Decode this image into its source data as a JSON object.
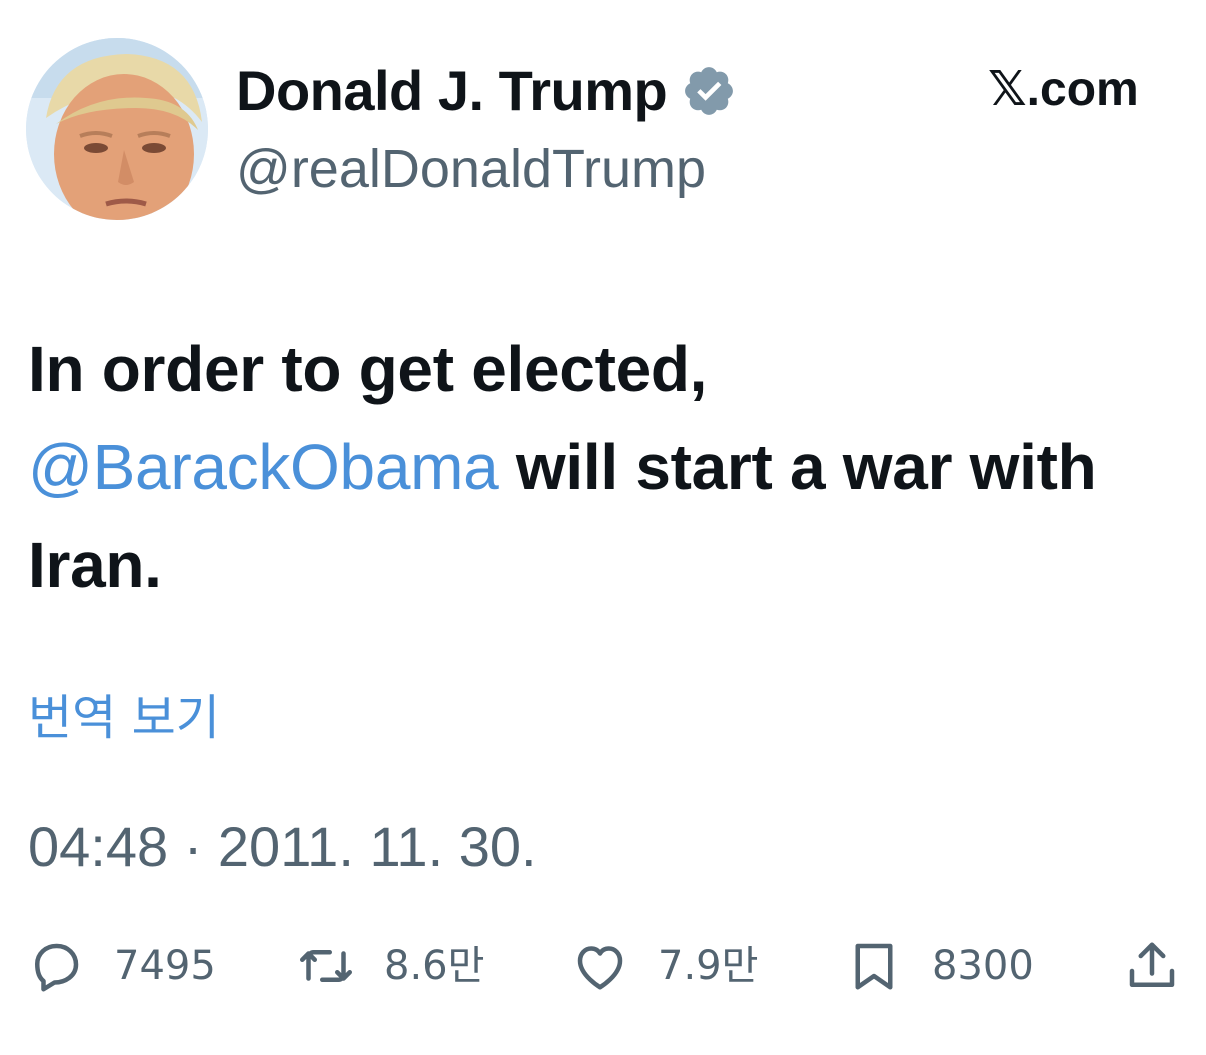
{
  "author": {
    "display_name": "Donald J. Trump",
    "handle": "@realDonaldTrump",
    "verified": true
  },
  "site_label": "𝕏.com",
  "tweet": {
    "line1": "In order to get elected,",
    "mention": "@BarackObama",
    "line2_rest": " will start a war with",
    "line3": "Iran."
  },
  "translate_label": "번역 보기",
  "timestamp": "04:48 · 2011. 11. 30.",
  "actions": {
    "replies": "7495",
    "retweets": "8.6만",
    "likes": "7.9만",
    "bookmarks": "8300"
  },
  "icons": {
    "reply": "speech-bubble-icon",
    "retweet": "retweet-icon",
    "like": "heart-icon",
    "bookmark": "bookmark-icon",
    "share": "share-icon",
    "verified": "verified-badge-icon"
  },
  "colors": {
    "text": "#0f1419",
    "secondary": "#536471",
    "link": "#4a90d9",
    "badge": "#829aab"
  }
}
